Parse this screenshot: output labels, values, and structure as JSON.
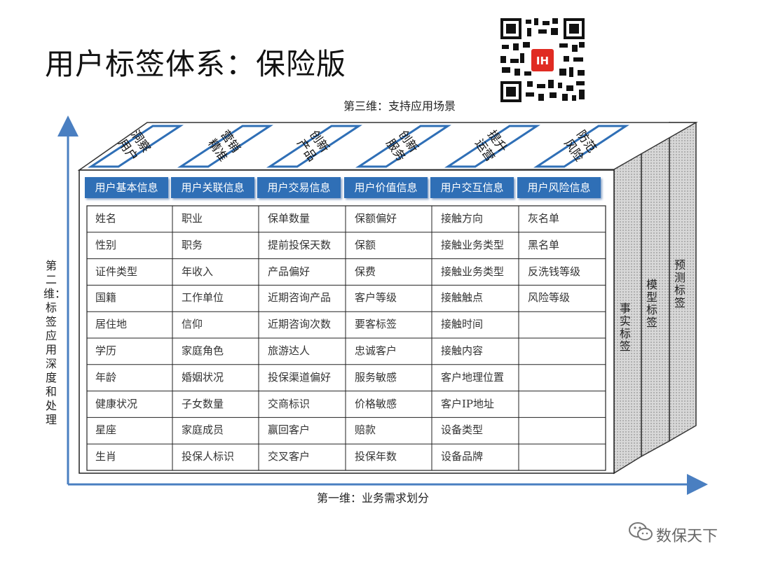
{
  "title": "用户标签体系：保险版",
  "axes": {
    "dimension1": "第一维：业务需求划分",
    "dimension2": "第二维：标签应用深度和处理",
    "dimension3": "第三维：支持应用场景"
  },
  "scenarios": [
    "用户洞察",
    "精准营销",
    "产品创新",
    "服务创新",
    "运营提升",
    "风险防范"
  ],
  "scenario_lines": [
    [
      "用户",
      "洞察"
    ],
    [
      "精准",
      "营销"
    ],
    [
      "产品",
      "创新"
    ],
    [
      "服务",
      "创新"
    ],
    [
      "运营",
      "提升"
    ],
    [
      "风险",
      "防范"
    ]
  ],
  "categories": [
    "用户基本信息",
    "用户关联信息",
    "用户交易信息",
    "用户价值信息",
    "用户交互信息",
    "用户风险信息"
  ],
  "columns": [
    [
      "姓名",
      "性别",
      "证件类型",
      "国籍",
      "居住地",
      "学历",
      "年龄",
      "健康状况",
      "星座",
      "生肖"
    ],
    [
      "职业",
      "职务",
      "年收入",
      "工作单位",
      "信仰",
      "家庭角色",
      "婚姻状况",
      "子女数量",
      "家庭成员",
      "投保人标识"
    ],
    [
      "保单数量",
      "提前投保天数",
      "产品偏好",
      "近期咨询产品",
      "近期咨询次数",
      "旅游达人",
      "投保渠道偏好",
      "交商标识",
      "赢回客户",
      "交叉客户"
    ],
    [
      "保额偏好",
      "保额",
      "保费",
      "客户等级",
      "要客标签",
      "忠诚客户",
      "服务敏感",
      "价格敏感",
      "赔款",
      "投保年数"
    ],
    [
      "接触方向",
      "接触业务类型",
      "接触业务类型",
      "接触触点",
      "接触时间",
      "接触内容",
      "客户地理位置",
      "客户IP地址",
      "设备类型",
      "设备品牌"
    ],
    [
      "灰名单",
      "黑名单",
      "反洗钱等级",
      "风险等级",
      "",
      "",
      "",
      "",
      "",
      ""
    ]
  ],
  "tag_layers": [
    "事实标签",
    "模型标签",
    "预测标签"
  ],
  "qr_badge": "IH",
  "watermark": "数保天下",
  "colors": {
    "accent": "#2f6fb6",
    "axis": "#4a7fc1",
    "border": "#222222"
  }
}
